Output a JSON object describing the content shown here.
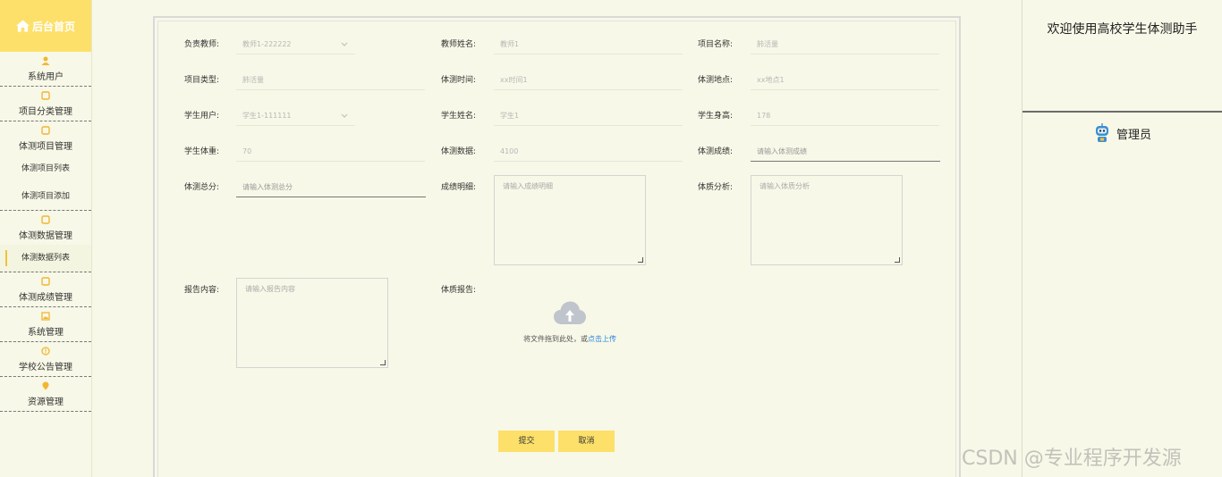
{
  "sidebar": {
    "brand": "后台首页",
    "groups": [
      {
        "label": "系统用户",
        "icon": "user-icon"
      },
      {
        "label": "项目分类管理",
        "icon": "tag-icon"
      },
      {
        "label": "体测项目管理",
        "icon": "tag-icon",
        "items": [
          "体测项目列表",
          "体测项目添加"
        ]
      },
      {
        "label": "体测数据管理",
        "icon": "tag-icon",
        "items": [
          "体测数据列表"
        ]
      },
      {
        "label": "体测成绩管理",
        "icon": "tag-icon"
      },
      {
        "label": "系统管理",
        "icon": "image-icon"
      },
      {
        "label": "学校公告管理",
        "icon": "info-icon"
      },
      {
        "label": "资源管理",
        "icon": "pin-icon"
      }
    ]
  },
  "right": {
    "welcome": "欢迎使用高校学生体测助手",
    "admin": "管理员"
  },
  "watermark": "CSDN @专业程序开发源",
  "form": {
    "teacher_account": {
      "label": "负责教师:",
      "value": "教师1-222222"
    },
    "teacher_name": {
      "label": "教师姓名:",
      "value": "教师1"
    },
    "project_name": {
      "label": "项目名称:",
      "value": "肺活量"
    },
    "project_type": {
      "label": "项目类型:",
      "value": "肺活量"
    },
    "test_time": {
      "label": "体测时间:",
      "value": "xx时间1"
    },
    "test_place": {
      "label": "体测地点:",
      "value": "xx地点1"
    },
    "student_account": {
      "label": "学生用户:",
      "value": "学生1-111111"
    },
    "student_name": {
      "label": "学生姓名:",
      "value": "学生1"
    },
    "student_height": {
      "label": "学生身高:",
      "value": "178"
    },
    "student_weight": {
      "label": "学生体重:",
      "value": "70"
    },
    "test_data": {
      "label": "体测数据:",
      "value": "4100"
    },
    "test_score": {
      "label": "体测成绩:",
      "placeholder": "请输入体测成绩"
    },
    "total_score": {
      "label": "体测总分:",
      "placeholder": "请输入体测总分"
    },
    "score_detail": {
      "label": "成绩明细:",
      "placeholder": "请输入成绩明细"
    },
    "physique_analysis": {
      "label": "体质分析:",
      "placeholder": "请输入体质分析"
    },
    "report_content": {
      "label": "报告内容:",
      "placeholder": "请输入报告内容"
    },
    "physique_report": {
      "label": "体质报告:"
    },
    "upload": {
      "text": "将文件拖到此处，或",
      "link": "点击上传"
    },
    "submit": "提交",
    "cancel": "取消"
  }
}
